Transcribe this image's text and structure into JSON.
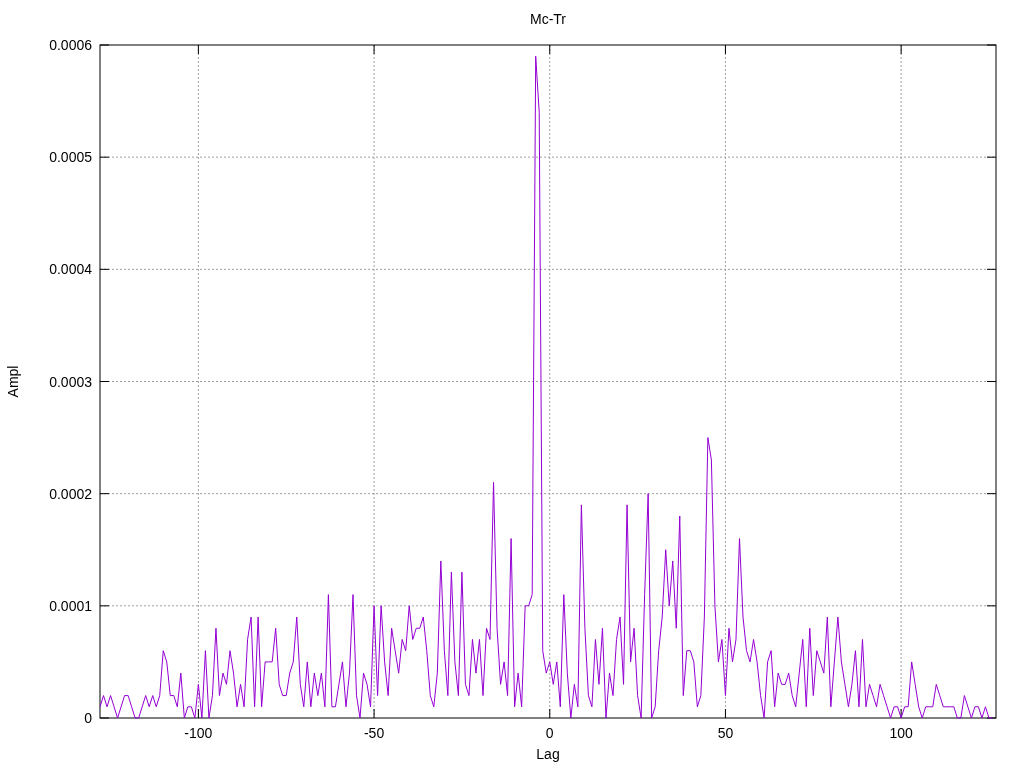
{
  "chart_data": {
    "type": "line",
    "grid": true,
    "title": "Mc-Tr",
    "xlabel": "Lag",
    "ylabel": "Ampl",
    "xlim": [
      -128,
      127
    ],
    "ylim": [
      0,
      0.0006
    ],
    "xticks": [
      -100,
      -50,
      0,
      50,
      100
    ],
    "yticks": [
      {
        "value": 0,
        "label": "0"
      },
      {
        "value": 0.0001,
        "label": "0.0001"
      },
      {
        "value": 0.0002,
        "label": "0.0002"
      },
      {
        "value": 0.0003,
        "label": "0.0003"
      },
      {
        "value": 0.0004,
        "label": "0.0004"
      },
      {
        "value": 0.0005,
        "label": "0.0005"
      },
      {
        "value": 0.0006,
        "label": "0.0006"
      }
    ],
    "x": [
      -128,
      -127,
      -126,
      -125,
      -124,
      -123,
      -122,
      -121,
      -120,
      -119,
      -118,
      -117,
      -116,
      -115,
      -114,
      -113,
      -112,
      -111,
      -110,
      -109,
      -108,
      -107,
      -106,
      -105,
      -104,
      -103,
      -102,
      -101,
      -100,
      -99,
      -98,
      -97,
      -96,
      -95,
      -94,
      -93,
      -92,
      -91,
      -90,
      -89,
      -88,
      -87,
      -86,
      -85,
      -84,
      -83,
      -82,
      -81,
      -80,
      -79,
      -78,
      -77,
      -76,
      -75,
      -74,
      -73,
      -72,
      -71,
      -70,
      -69,
      -68,
      -67,
      -66,
      -65,
      -64,
      -63,
      -62,
      -61,
      -60,
      -59,
      -58,
      -57,
      -56,
      -55,
      -54,
      -53,
      -52,
      -51,
      -50,
      -49,
      -48,
      -47,
      -46,
      -45,
      -44,
      -43,
      -42,
      -41,
      -40,
      -39,
      -38,
      -37,
      -36,
      -35,
      -34,
      -33,
      -32,
      -31,
      -30,
      -29,
      -28,
      -27,
      -26,
      -25,
      -24,
      -23,
      -22,
      -21,
      -20,
      -19,
      -18,
      -17,
      -16,
      -15,
      -14,
      -13,
      -12,
      -11,
      -10,
      -9,
      -8,
      -7,
      -6,
      -5,
      -4,
      -3,
      -2,
      -1,
      0,
      1,
      2,
      3,
      4,
      5,
      6,
      7,
      8,
      9,
      10,
      11,
      12,
      13,
      14,
      15,
      16,
      17,
      18,
      19,
      20,
      21,
      22,
      23,
      24,
      25,
      26,
      27,
      28,
      29,
      30,
      31,
      32,
      33,
      34,
      35,
      36,
      37,
      38,
      39,
      40,
      41,
      42,
      43,
      44,
      45,
      46,
      47,
      48,
      49,
      50,
      51,
      52,
      53,
      54,
      55,
      56,
      57,
      58,
      59,
      60,
      61,
      62,
      63,
      64,
      65,
      66,
      67,
      68,
      69,
      70,
      71,
      72,
      73,
      74,
      75,
      76,
      77,
      78,
      79,
      80,
      81,
      82,
      83,
      84,
      85,
      86,
      87,
      88,
      89,
      90,
      91,
      92,
      93,
      94,
      95,
      96,
      97,
      98,
      99,
      100,
      101,
      102,
      103,
      104,
      105,
      106,
      107,
      108,
      109,
      110,
      111,
      112,
      113,
      114,
      115,
      116,
      117,
      118,
      119,
      120,
      121,
      122,
      123,
      124,
      125,
      126
    ],
    "series": [
      {
        "color": "#9400d3",
        "values": [
          1e-05,
          2e-05,
          1e-05,
          2e-05,
          1e-05,
          0,
          1e-05,
          2e-05,
          2e-05,
          1e-05,
          0,
          0,
          1e-05,
          2e-05,
          1e-05,
          2e-05,
          1e-05,
          2e-05,
          6e-05,
          5e-05,
          2e-05,
          2e-05,
          1e-05,
          4e-05,
          0,
          1e-05,
          1e-05,
          0,
          3e-05,
          0,
          6e-05,
          0,
          2e-05,
          8e-05,
          2e-05,
          4e-05,
          3e-05,
          6e-05,
          4e-05,
          1e-05,
          3e-05,
          1e-05,
          7e-05,
          9e-05,
          1e-05,
          9e-05,
          1e-05,
          5e-05,
          5e-05,
          5e-05,
          8e-05,
          3e-05,
          2e-05,
          2e-05,
          4e-05,
          5e-05,
          9e-05,
          3e-05,
          1e-05,
          5e-05,
          1e-05,
          4e-05,
          2e-05,
          4e-05,
          1e-05,
          0.00011,
          1e-05,
          1e-05,
          3e-05,
          5e-05,
          1e-05,
          4e-05,
          0.00011,
          2e-05,
          0,
          4e-05,
          3e-05,
          1e-05,
          0.0001,
          2e-05,
          0.0001,
          5e-05,
          2e-05,
          8e-05,
          6e-05,
          4e-05,
          7e-05,
          6e-05,
          0.0001,
          7e-05,
          8e-05,
          8e-05,
          9e-05,
          6e-05,
          2e-05,
          1e-05,
          4e-05,
          0.00014,
          6e-05,
          2e-05,
          0.00013,
          5e-05,
          2e-05,
          0.00013,
          3e-05,
          2e-05,
          7e-05,
          4e-05,
          7e-05,
          2e-05,
          8e-05,
          7e-05,
          0.00021,
          8e-05,
          3e-05,
          5e-05,
          2e-05,
          0.00016,
          1e-05,
          4e-05,
          1e-05,
          0.0001,
          0.0001,
          0.00011,
          0.00059,
          0.00054,
          6e-05,
          4e-05,
          5e-05,
          3e-05,
          5e-05,
          1e-05,
          0.00011,
          4e-05,
          0,
          3e-05,
          1e-05,
          0.00019,
          8e-05,
          2e-05,
          1e-05,
          7e-05,
          3e-05,
          8e-05,
          0,
          4e-05,
          2e-05,
          7e-05,
          9e-05,
          3e-05,
          0.00019,
          5e-05,
          8e-05,
          2e-05,
          0,
          0.00011,
          0.0002,
          0,
          1e-05,
          6e-05,
          9e-05,
          0.00015,
          0.0001,
          0.00014,
          8e-05,
          0.00018,
          2e-05,
          6e-05,
          6e-05,
          5e-05,
          1e-05,
          2e-05,
          9e-05,
          0.00025,
          0.00023,
          0.0001,
          5e-05,
          7e-05,
          2e-05,
          8e-05,
          5e-05,
          7e-05,
          0.00016,
          9e-05,
          6e-05,
          5e-05,
          7e-05,
          5e-05,
          2e-05,
          0,
          5e-05,
          6e-05,
          1e-05,
          4e-05,
          3e-05,
          3e-05,
          4e-05,
          2e-05,
          1e-05,
          4e-05,
          7e-05,
          1e-05,
          8e-05,
          2e-05,
          6e-05,
          5e-05,
          4e-05,
          9e-05,
          1e-05,
          5e-05,
          9e-05,
          5e-05,
          3e-05,
          1e-05,
          3e-05,
          6e-05,
          1e-05,
          7e-05,
          1e-05,
          3e-05,
          2e-05,
          1e-05,
          3e-05,
          2e-05,
          1e-05,
          0,
          1e-05,
          1e-05,
          0,
          1e-05,
          1e-05,
          5e-05,
          3e-05,
          1e-05,
          0,
          1e-05,
          1e-05,
          1e-05,
          3e-05,
          2e-05,
          1e-05,
          1e-05,
          1e-05,
          1e-05,
          0,
          0,
          2e-05,
          1e-05,
          0,
          1e-05,
          1e-05,
          0,
          1e-05,
          0,
          0
        ]
      }
    ]
  }
}
